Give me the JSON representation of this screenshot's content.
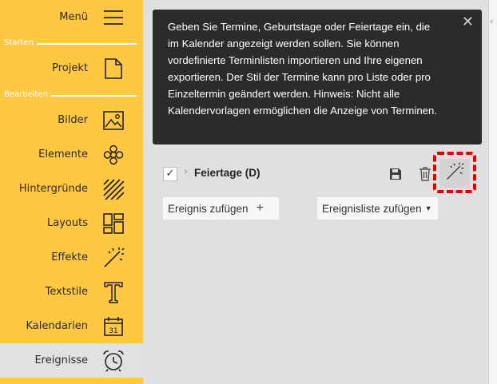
{
  "sidebar": {
    "menu_label": "Menü",
    "sections": {
      "starten": "Starten",
      "bearbeiten": "Bearbeiten"
    },
    "items": {
      "projekt": "Projekt",
      "bilder": "Bilder",
      "elemente": "Elemente",
      "hintergruende": "Hintergründe",
      "layouts": "Layouts",
      "effekte": "Effekte",
      "textstile": "Textstile",
      "kalendarien": "Kalendarien",
      "ereignisse": "Ereignisse"
    },
    "calendar_icon_number": "31"
  },
  "tooltip": {
    "text": "Geben Sie Termine, Geburtstage oder Feiertage ein, die im Kalender angezeigt werden sollen. Sie können vordefinierte Terminlisten importieren und Ihre eigenen exportieren. Der Stil der Termine kann pro Liste oder pro Einzeltermin geändert werden. Hinweis: Nicht alle Kalendervorlagen ermöglichen die Anzeige von Terminen.",
    "close_symbol": "✕"
  },
  "event_list": {
    "checked_symbol": "✓",
    "title": "Feiertage (D)"
  },
  "buttons": {
    "add_event": "Ereignis zufügen",
    "add_event_icon": "+",
    "add_list": "Ereignisliste zufügen"
  },
  "colors": {
    "sidebar_bg": "#ffc843",
    "main_bg": "#e0e0e0",
    "tooltip_bg": "#2b2b2b",
    "highlight": "#e60000"
  }
}
